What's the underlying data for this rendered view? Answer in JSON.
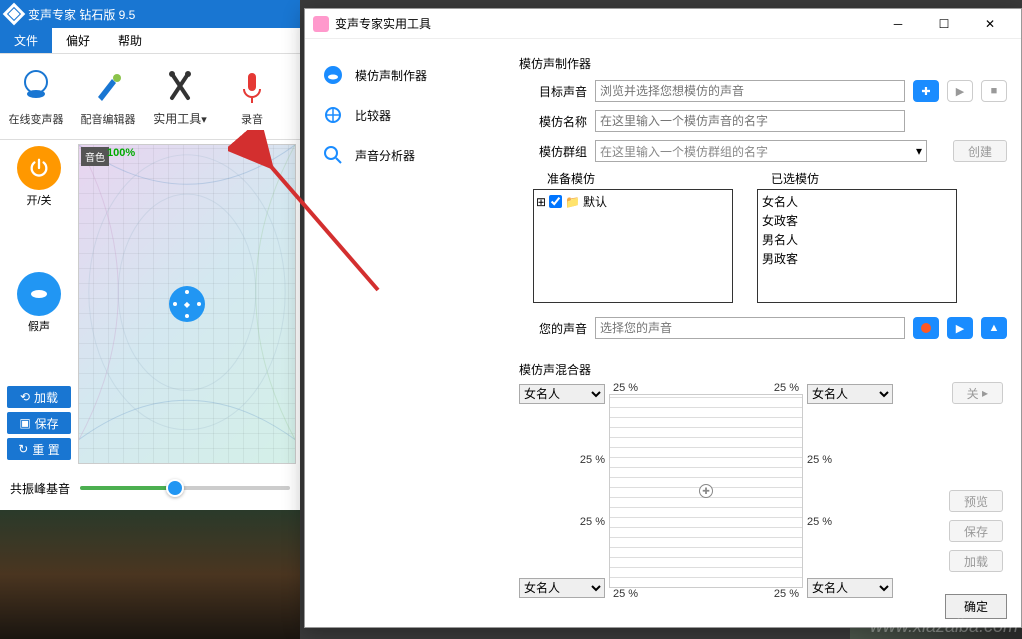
{
  "main": {
    "title": "变声专家  钻石版  9.5",
    "menu": {
      "file": "文件",
      "pref": "偏好",
      "help": "帮助"
    },
    "toolbar": {
      "online": "在线变声器",
      "editor": "配音编辑器",
      "tools": "实用工具",
      "record": "录音"
    },
    "side": {
      "power": "开/关",
      "fake": "假声",
      "load": "加载",
      "save": "保存",
      "reset": "重 置"
    },
    "graph": {
      "tone_label": "音色",
      "tone_value": "100%"
    },
    "slider_label": "共振峰基音"
  },
  "dialog": {
    "title": "变声专家实用工具",
    "nav": {
      "maker": "模仿声制作器",
      "compare": "比较器",
      "analyzer": "声音分析器"
    },
    "content": {
      "section": "模仿声制作器",
      "target_label": "目标声音",
      "target_placeholder": "浏览并选择您想模仿的声音",
      "name_label": "模仿名称",
      "name_placeholder": "在这里输入一个模仿声音的名字",
      "group_label": "模仿群组",
      "group_placeholder": "在这里输入一个模仿群组的名字",
      "create_btn": "创建",
      "prep_label": "准备模仿",
      "prep_default": "默认",
      "selected_label": "已选模仿",
      "selected_items": [
        "女名人",
        "女政客",
        "男名人",
        "男政客"
      ],
      "your_voice_label": "您的声音",
      "your_voice_placeholder": "选择您的声音",
      "mixer_label": "模仿声混合器",
      "pct": "25 %",
      "select_val": "女名人",
      "off_btn": "关",
      "preview_btn": "预览",
      "save_btn": "保存",
      "load_btn": "加载",
      "ok_btn": "确定"
    }
  },
  "watermark": "www.xiazaiba.com"
}
